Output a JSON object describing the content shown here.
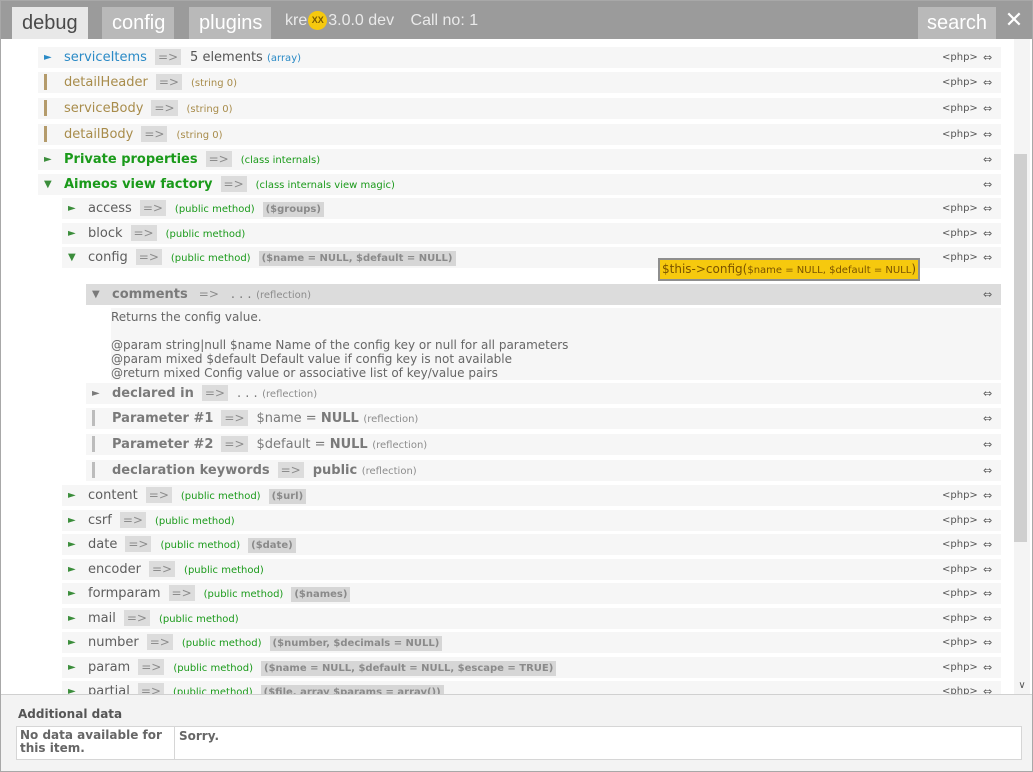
{
  "header": {
    "tabs": [
      {
        "label": "debug"
      },
      {
        "label": "config"
      },
      {
        "label": "plugins"
      }
    ],
    "app_prefix": "kre",
    "badge": "XX",
    "version": "3.0.0 dev",
    "call_no": "Call no: 1",
    "search_label": "search",
    "close_glyph": "✕"
  },
  "common": {
    "arrow": "=>",
    "php": "<php>",
    "lr": "⇔",
    "exp_right": "►",
    "exp_down": "▼"
  },
  "rows": {
    "serviceItems": {
      "name": "serviceItems",
      "value": "5 elements",
      "type": "(array)"
    },
    "detailHeader": {
      "name": "detailHeader",
      "type": "(string 0)"
    },
    "serviceBody": {
      "name": "serviceBody",
      "type": "(string 0)"
    },
    "detailBody": {
      "name": "detailBody",
      "type": "(string 0)"
    },
    "private": {
      "name": "Private properties",
      "type": "(class internals)"
    },
    "factory": {
      "name": "Aimeos view factory",
      "type": "(class internals view magic)"
    },
    "access": {
      "name": "access",
      "type": "(public method)",
      "sig": "($groups)"
    },
    "block": {
      "name": "block",
      "type": "(public method)"
    },
    "config": {
      "name": "config",
      "type": "(public method)",
      "sig": "($name = NULL, $default = NULL)"
    },
    "comments": {
      "name": "comments",
      "value": ". . .",
      "type": "(reflection)"
    },
    "declared": {
      "name": "declared in",
      "value": ". . .",
      "type": "(reflection)"
    },
    "param1": {
      "name": "Parameter #1",
      "value": "$name = ",
      "value_b": "NULL",
      "type": "(reflection)"
    },
    "param2": {
      "name": "Parameter #2",
      "value": "$default = ",
      "value_b": "NULL",
      "type": "(reflection)"
    },
    "keywords": {
      "name": "declaration keywords",
      "value": "public",
      "type": "(reflection)"
    },
    "content": {
      "name": "content",
      "type": "(public method)",
      "sig": "($url)"
    },
    "csrf": {
      "name": "csrf",
      "type": "(public method)"
    },
    "date": {
      "name": "date",
      "type": "(public method)",
      "sig": "($date)"
    },
    "encoder": {
      "name": "encoder",
      "type": "(public method)"
    },
    "formparam": {
      "name": "formparam",
      "type": "(public method)",
      "sig": "($names)"
    },
    "mail": {
      "name": "mail",
      "type": "(public method)"
    },
    "number": {
      "name": "number",
      "type": "(public method)",
      "sig": "($number, $decimals = NULL)"
    },
    "param": {
      "name": "param",
      "type": "(public method)",
      "sig": "($name = NULL, $default = NULL, $escape = TRUE)"
    },
    "partial": {
      "name": "partial",
      "type": "(public method)",
      "sig": "($file, array $params = array())"
    }
  },
  "docblock": {
    "lines": [
      "Returns the config value.",
      "",
      "@param string|null $name Name of the config key or null for all parameters",
      "@param mixed $default Default value if config key is not available",
      "@return mixed Config value or associative list of key/value pairs"
    ]
  },
  "tooltip": {
    "call": "$this->config(",
    "args": "$name = NULL, $default = NULL",
    "close": ")"
  },
  "footer": {
    "title": "Additional data",
    "key": "No data available for this item.",
    "value": "Sorry."
  },
  "colors": {
    "header_bg": "#9b9b9b",
    "tab_active_bg": "#e8e8e8",
    "accent_yellow": "#f6c90e",
    "method_green": "#1a9a1a",
    "array_blue": "#2a8ac6",
    "string_gold": "#a88c4b"
  }
}
